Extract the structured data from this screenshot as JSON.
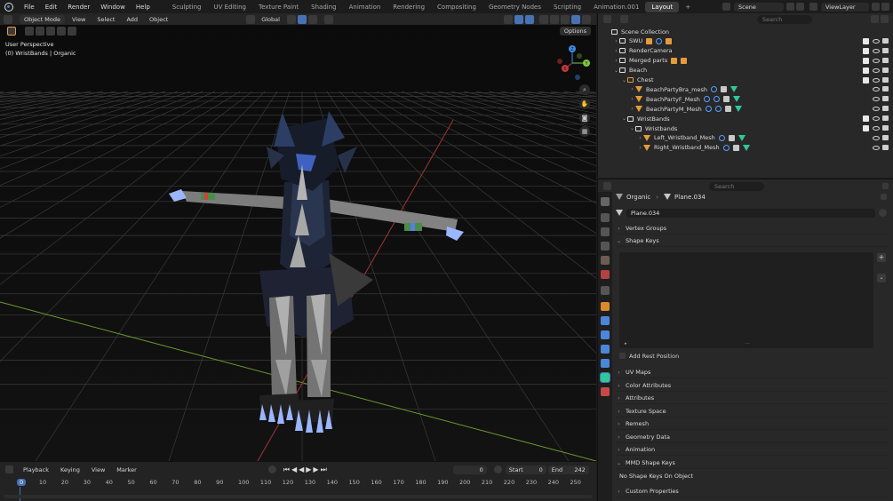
{
  "topbar": {
    "menus": [
      "File",
      "Edit",
      "Render",
      "Window",
      "Help"
    ],
    "workspaces": [
      "Sculpting",
      "UV Editing",
      "Texture Paint",
      "Shading",
      "Animation",
      "Rendering",
      "Compositing",
      "Geometry Nodes",
      "Scripting",
      "Animation.001",
      "Layout"
    ],
    "active_workspace": "Layout",
    "add_tab": "+",
    "scene": "Scene",
    "view_layer": "ViewLayer"
  },
  "viewport": {
    "mode": "Object Mode",
    "menus": [
      "View",
      "Select",
      "Add",
      "Object"
    ],
    "transform_orientation": "Global",
    "options_label": "Options",
    "perspective_label": "User Perspective",
    "object_label": "(0) WristBands | Organic",
    "gizmo_axes": {
      "x": "X",
      "y": "Y",
      "z": "Z"
    }
  },
  "timeline": {
    "menus": [
      "Playback",
      "Keying",
      "View",
      "Marker"
    ],
    "current_frame": "0",
    "start_label": "Start",
    "start": "0",
    "end_label": "End",
    "end": "242",
    "ruler": [
      "0",
      "10",
      "20",
      "30",
      "40",
      "50",
      "60",
      "70",
      "80",
      "90",
      "100",
      "110",
      "120",
      "130",
      "140",
      "150",
      "160",
      "170",
      "180",
      "190",
      "200",
      "210",
      "220",
      "230",
      "240",
      "250"
    ]
  },
  "outliner": {
    "search_placeholder": "Search",
    "items": [
      {
        "label": "Scene Collection",
        "indent": 0,
        "type": "scene"
      },
      {
        "label": "SWU",
        "indent": 1,
        "type": "collection"
      },
      {
        "label": "RenderCamera",
        "indent": 1,
        "type": "collection"
      },
      {
        "label": "Merged parts",
        "indent": 1,
        "type": "collection"
      },
      {
        "label": "Beach",
        "indent": 1,
        "type": "collection"
      },
      {
        "label": "Chest",
        "indent": 2,
        "type": "collection"
      },
      {
        "label": "BeachPartyBra_mesh",
        "indent": 3,
        "type": "mesh"
      },
      {
        "label": "BeachPartyF_Mesh",
        "indent": 3,
        "type": "mesh"
      },
      {
        "label": "BeachPartyM_Mesh",
        "indent": 3,
        "type": "mesh"
      },
      {
        "label": "WristBands",
        "indent": 2,
        "type": "collection"
      },
      {
        "label": "Wristbands",
        "indent": 3,
        "type": "collection"
      },
      {
        "label": "Left_Wristband_Mesh",
        "indent": 4,
        "type": "mesh"
      },
      {
        "label": "Right_Wristband_Mesh",
        "indent": 4,
        "type": "mesh"
      }
    ]
  },
  "properties": {
    "search_placeholder": "Search",
    "breadcrumb_object": "Organic",
    "breadcrumb_data": "Plane.034",
    "data_name": "Plane.034",
    "panels_top": [
      "Vertex Groups",
      "Shape Keys"
    ],
    "add_rest_position": "Add Rest Position",
    "panels_bottom": [
      "UV Maps",
      "Color Attributes",
      "Attributes",
      "Texture Space",
      "Remesh",
      "Geometry Data",
      "Animation",
      "MMD Shape Keys"
    ],
    "mmd_note": "No Shape Keys On Object",
    "custom_properties": "Custom Properties"
  },
  "colors": {
    "accent": "#4772b3",
    "mesh": "#e69b3a",
    "data": "#2ec99b",
    "x_axis": "#c8383c",
    "y_axis": "#7ec83c",
    "z_axis": "#3c8ce6"
  }
}
